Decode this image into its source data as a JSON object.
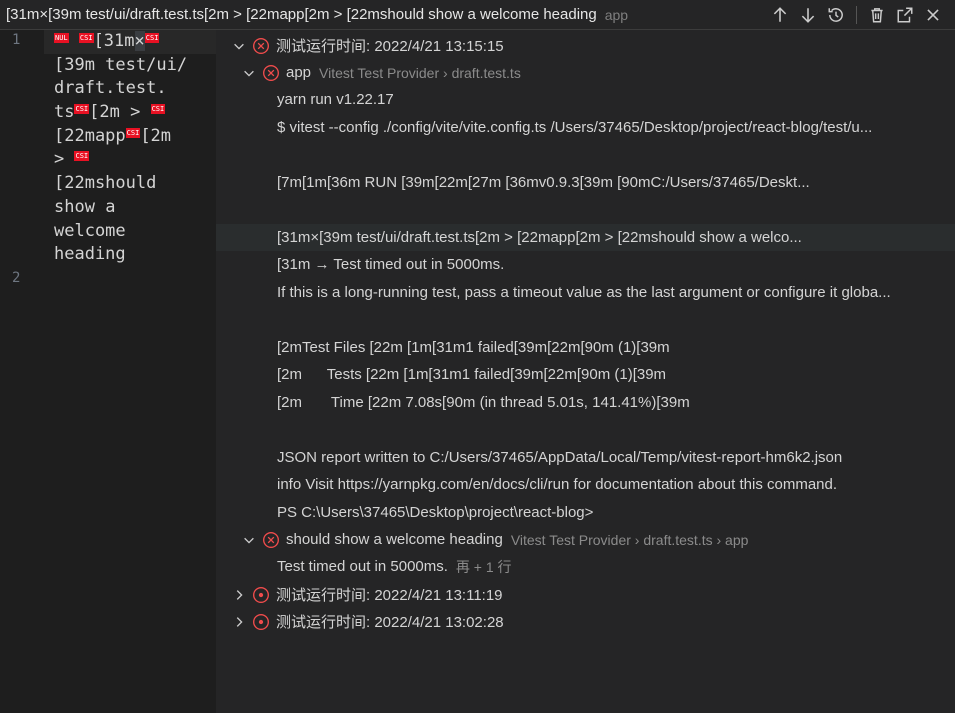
{
  "titlebar": {
    "title": "\u001b[31m×\u001b[39m test/ui/draft.test.ts\u001b[2m > \u001b[22mapp\u001b[2m > \u001b[22mshould show a welcome heading",
    "title_display": "[31m×[39m test/ui/draft.test.ts[2m > [22mapp[2m > [22mshould show a welcome heading",
    "subtitle": "app",
    "actions": [
      "arrow-up-icon",
      "arrow-down-icon",
      "history-icon",
      "trash-icon",
      "open-external-icon",
      "close-icon"
    ]
  },
  "editor": {
    "line_numbers": [
      "1",
      "2"
    ],
    "code_lines": [
      "[31m×[39m test/ui/",
      "draft.test.",
      "ts[2m > [22mapp[2m > [22mshould show a welcome heading"
    ],
    "visual_lines": {
      "l1_a": "[31m",
      "l1_b": "×",
      "l2": "[39m test/ui/",
      "l3": "draft.test.",
      "l4_a": "ts",
      "l4_b": "[2m > ",
      "l5_a": "[22mapp",
      "l5_b": "[2m",
      "l6": "> ",
      "l7": "[22mshould",
      "l8_a": "show",
      "l8_b": "a",
      "l9": "welcome",
      "l10": "heading"
    },
    "ctl_labels": {
      "nul": "NUL",
      "csi": "CSI"
    }
  },
  "output": {
    "run1_label": "测试运行时间: 2022/4/21 13:15:15",
    "app_label": "app",
    "app_provider": "Vitest Test Provider › draft.test.ts",
    "log_lines": [
      "yarn run v1.22.17",
      "$ vitest --config ./config/vite/vite.config.ts /Users/37465/Desktop/project/react-blog/test/u...",
      "",
      "[7m[1m[36m RUN [39m[22m[27m [36mv0.9.3[39m [90mC:/Users/37465/Deskt...",
      "",
      " [31m×[39m test/ui/draft.test.ts[2m > [22mapp[2m > [22mshould show a welco...",
      "[31m   → Test timed out in 5000ms.",
      "If this is a long-running test, pass a timeout value as the last argument or configure it globa...",
      "",
      "[2mTest Files [22m [1m[31m1 failed[39m[22m[90m (1)[39m",
      "[2m      Tests [22m [1m[31m1 failed[39m[22m[90m (1)[39m",
      "[2m       Time [22m 7.08s[90m (in thread 5.01s, 141.41%)[39m",
      "",
      "JSON report written to C:/Users/37465/AppData/Local/Temp/vitest-report-hm6k2.json",
      "info Visit https://yarnpkg.com/en/docs/cli/run for documentation about this command.",
      "PS C:\\Users\\37465\\Desktop\\project\\react-blog>"
    ],
    "test_label": "should show a welcome heading",
    "test_provider": "Vitest Test Provider › draft.test.ts › app",
    "test_message": "Test timed out in 5000ms.",
    "test_more": "再 + 1 行",
    "run2_label": "测试运行时间: 2022/4/21 13:11:19",
    "run3_label": "测试运行时间: 2022/4/21 13:02:28"
  },
  "colors": {
    "error": "#f14c4c",
    "pending": "#f14c4c",
    "bg_output": "#252526",
    "bg_editor": "#1e1e1e"
  }
}
